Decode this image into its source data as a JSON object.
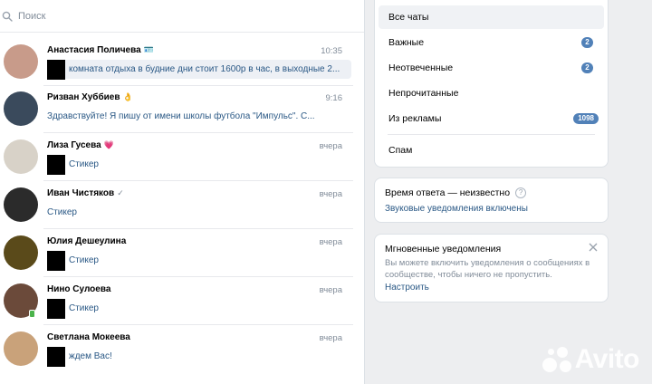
{
  "search": {
    "placeholder": "Поиск"
  },
  "dialogs": [
    {
      "name": "Анастасия Поличева",
      "emoji": "🪪",
      "time": "10:35",
      "preview": "комната отдыха в будние дни стоит 1600р в час, в выходные 2...",
      "unread": true,
      "has_mini_avatar": true,
      "avatar_color": "#c89b8a"
    },
    {
      "name": "Ризван Хуббиев",
      "emoji": "👌",
      "time": "9:16",
      "preview": "Здравствуйте! Я пишу от имени школы футбола \"Импульс\". С...",
      "unread": false,
      "has_mini_avatar": false,
      "avatar_color": "#3a4a5c"
    },
    {
      "name": "Лиза Гусева",
      "emoji": "💗",
      "time": "вчера",
      "preview": "Стикер",
      "unread": false,
      "has_mini_avatar": true,
      "avatar_color": "#d8d2c8"
    },
    {
      "name": "Иван Чистяков",
      "emoji": "✓",
      "time": "вчера",
      "preview": "Стикер",
      "unread": false,
      "has_mini_avatar": false,
      "avatar_color": "#2b2b2b"
    },
    {
      "name": "Юлия Дешеулина",
      "emoji": "",
      "time": "вчера",
      "preview": "Стикер",
      "unread": false,
      "has_mini_avatar": true,
      "avatar_color": "#5a4a1a"
    },
    {
      "name": "Нино Сулоева",
      "emoji": "",
      "time": "вчера",
      "preview": "Стикер",
      "unread": false,
      "has_mini_avatar": true,
      "avatar_color": "#6b4a3a",
      "online": true
    },
    {
      "name": "Светлана Мокеева",
      "emoji": "",
      "time": "вчера",
      "preview": "ждем Вас!",
      "unread": false,
      "has_mini_avatar": true,
      "avatar_color": "#c9a27a"
    }
  ],
  "filters": {
    "items": [
      {
        "label": "Все чаты",
        "count": ""
      },
      {
        "label": "Важные",
        "count": "2"
      },
      {
        "label": "Неотвеченные",
        "count": "2"
      },
      {
        "label": "Непрочитанные",
        "count": ""
      },
      {
        "label": "Из рекламы",
        "count": "1098"
      },
      {
        "label": "Спам",
        "count": ""
      }
    ]
  },
  "response": {
    "time_label": "Время ответа — неизвестно",
    "help_icon": "?",
    "sound_link": "Звуковые уведомления включены"
  },
  "notifications": {
    "title": "Мгновенные уведомления",
    "body": "Вы можете включить уведомления о сообщениях в сообществе, чтобы ничего не пропустить.",
    "link": "Настроить"
  },
  "watermark": {
    "text": "Avito"
  },
  "colors": {
    "accent": "#2a5885",
    "badge": "#5181b8",
    "muted": "#818c99",
    "bg": "#edeef0"
  }
}
